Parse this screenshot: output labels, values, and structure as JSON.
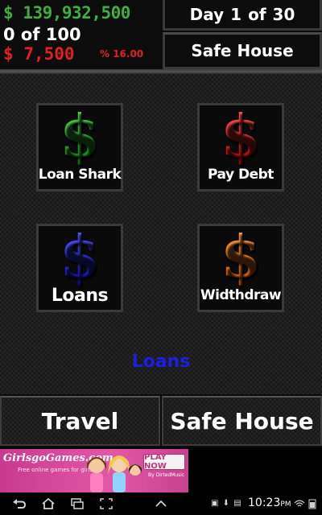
{
  "header": {
    "cash_symbol": "$",
    "cash_amount": "139,932,500",
    "inventory": "0  of  100",
    "debt_symbol": "$",
    "debt_amount": "7,500",
    "interest": "% 16.00",
    "day_label": "Day",
    "day_current": "1",
    "day_of": "of",
    "day_total": "30",
    "location": "Safe House"
  },
  "tiles": [
    {
      "label": "Loan Shark",
      "icon": "green-dollar-icon",
      "color": "#1f9a1f"
    },
    {
      "label": "Pay Debt",
      "icon": "red-dollar-icon",
      "color": "#d81b1b"
    },
    {
      "label": "Loans",
      "icon": "blue-dollar-icon",
      "color": "#1c1cd6"
    },
    {
      "label": "Widthdraw",
      "icon": "orange-dollar-icon",
      "color": "#e06b10"
    }
  ],
  "dollar_glyph": "$",
  "section_label": "Loans",
  "bottom": {
    "travel": "Travel",
    "safe_house": "Safe House"
  },
  "ad": {
    "brand": "GirlsgoGames.com",
    "tagline": "Free online games for girls",
    "cta": "PLAY NOW",
    "cta_sub": "By DirtedMusic"
  },
  "system": {
    "clock": "10:23",
    "ampm": "PM",
    "icons": [
      "back-icon",
      "home-icon",
      "recent-apps-icon",
      "screenshot-icon",
      "menu-up-icon"
    ]
  },
  "colors": {
    "cash": "#3fae3f",
    "debt": "#e02020",
    "section_label": "#1e1ee0"
  }
}
